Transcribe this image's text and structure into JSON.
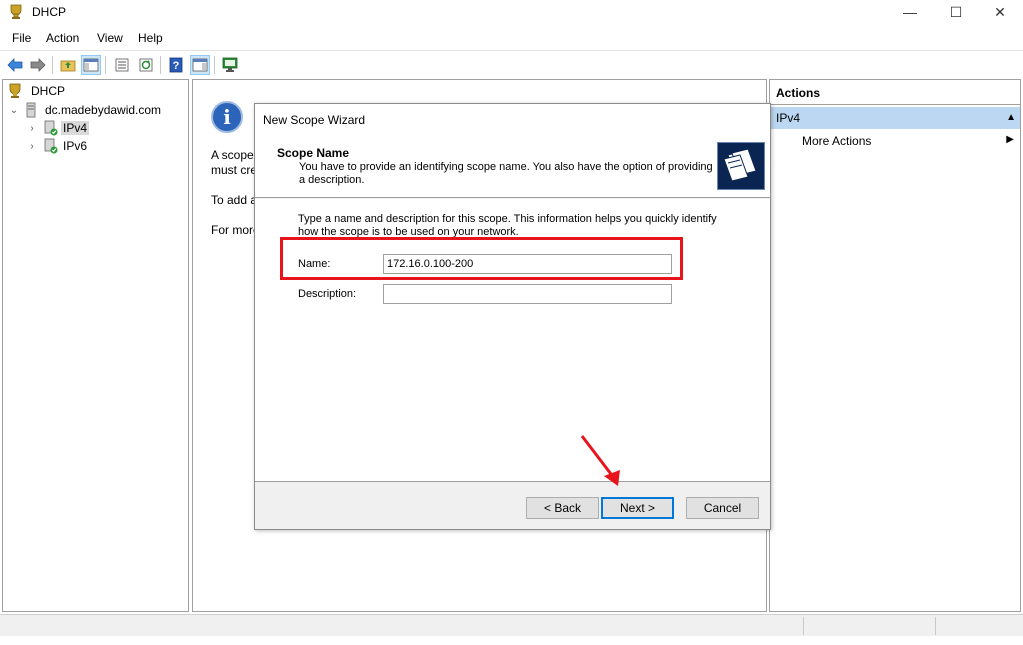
{
  "window": {
    "title": "DHCP",
    "min": "—",
    "max": "☐",
    "close": "✕"
  },
  "menu": [
    {
      "label": "File"
    },
    {
      "label": "Action"
    },
    {
      "label": "View"
    },
    {
      "label": "Help"
    }
  ],
  "toolbar": {
    "buttons": [
      {
        "icon": "back-arrow-icon"
      },
      {
        "icon": "forward-arrow-icon"
      },
      {
        "icon": "up-folder-icon"
      },
      {
        "icon": "show-hide-console-tree-icon"
      },
      {
        "icon": "properties-icon"
      },
      {
        "icon": "refresh-icon"
      },
      {
        "icon": "help-icon"
      },
      {
        "icon": "show-hide-action-pane-icon"
      },
      {
        "icon": "server-monitor-icon"
      }
    ]
  },
  "tree": {
    "root": "DHCP",
    "server": "dc.madebydawid.com",
    "ipv4": "IPv4",
    "ipv6": "IPv6"
  },
  "center": {
    "line1": "A scope",
    "line2": "must cre",
    "line3": "To add a",
    "line4": "For more"
  },
  "actions": {
    "title": "Actions",
    "section": "IPv4",
    "more": "More Actions"
  },
  "wizard": {
    "title": "New Scope Wizard",
    "heading": "Scope Name",
    "description": "You have to provide an identifying scope name. You also have the option of providing a description.",
    "intro": "Type a name and description for this scope. This information helps you quickly identify how the scope is to be used on your network.",
    "name_label": "Name:",
    "name_value": "172.16.0.100-200",
    "description_label": "Description:",
    "description_value": "",
    "back_label": "< Back",
    "next_label": "Next >",
    "cancel_label": "Cancel"
  },
  "colors": {
    "selection": "#bcd7f2",
    "highlight_annotation": "#e8141c",
    "default_button_border": "#0078d7",
    "info_icon": "#2b64b8"
  }
}
